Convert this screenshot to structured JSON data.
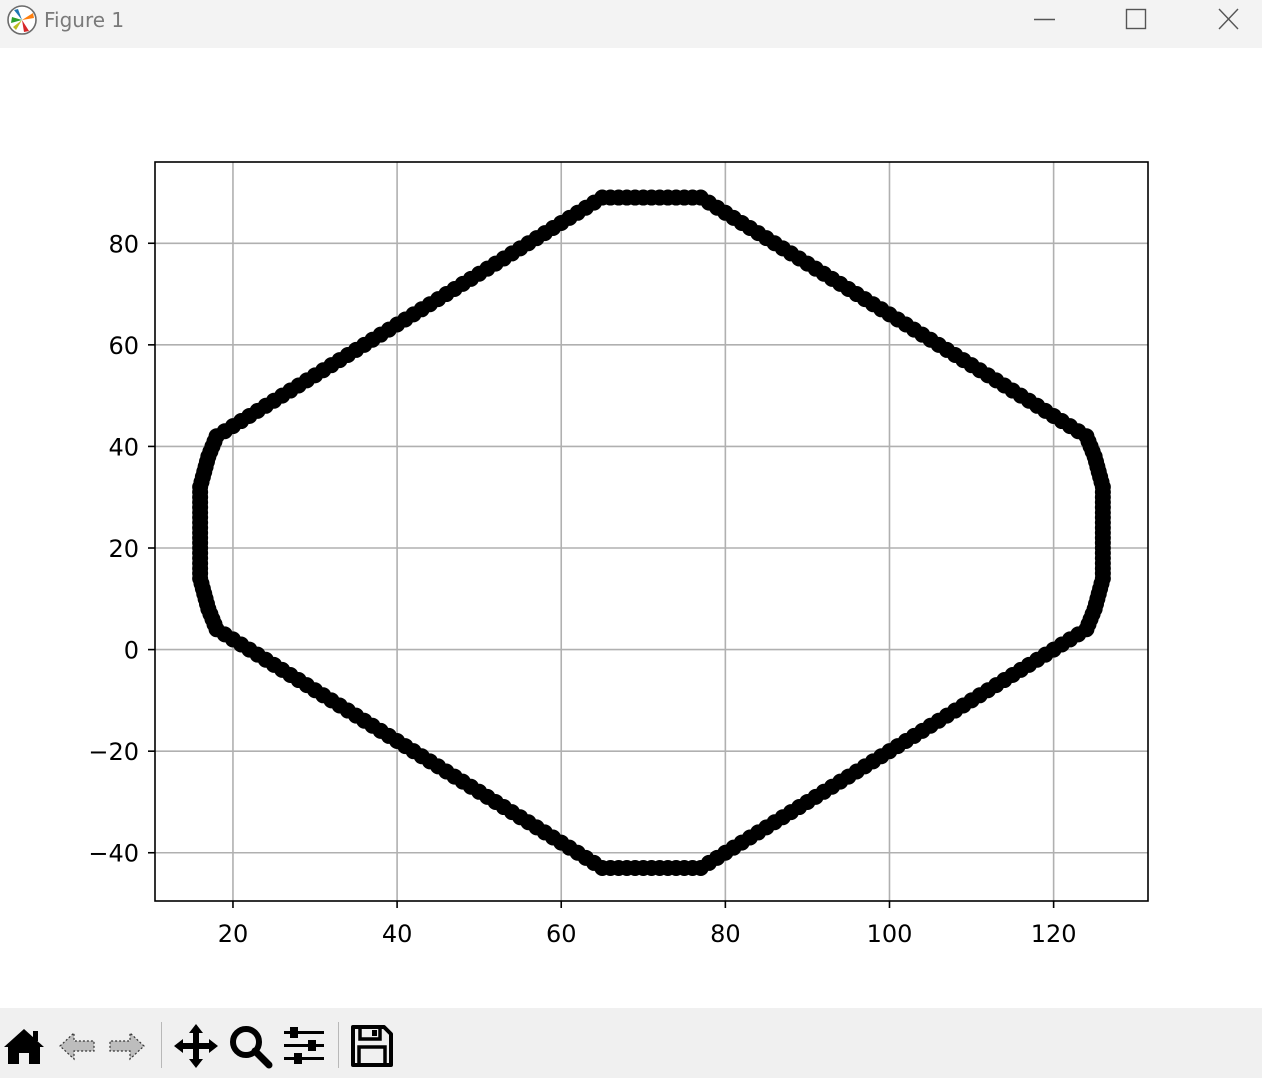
{
  "window": {
    "title": "Figure 1",
    "icon": "matplotlib-logo-icon",
    "controls": [
      "minimize-icon",
      "maximize-icon",
      "close-icon"
    ]
  },
  "toolbar": {
    "tools": [
      "home-icon",
      "back-arrow-icon",
      "forward-arrow-icon",
      "pan-move-icon",
      "zoom-magnifier-icon",
      "configure-subplots-icon",
      "save-floppy-icon"
    ]
  },
  "chart_data": {
    "type": "scatter",
    "title": "",
    "xlabel": "",
    "ylabel": "",
    "xlim": [
      10.5,
      131.5
    ],
    "ylim": [
      -49.5,
      96
    ],
    "grid": true,
    "marker_color": "#000000",
    "xticks": [
      20,
      40,
      60,
      80,
      100,
      120
    ],
    "yticks": [
      -40,
      -20,
      0,
      20,
      40,
      60,
      80
    ],
    "xtick_labels": [
      "20",
      "40",
      "60",
      "80",
      "100",
      "120"
    ],
    "ytick_labels": [
      "−40",
      "−20",
      "0",
      "20",
      "40",
      "60",
      "80"
    ],
    "series": [
      {
        "vertices": [
          [
            65,
            89
          ],
          [
            77,
            89
          ],
          [
            124,
            42
          ],
          [
            125,
            38
          ],
          [
            126,
            32
          ],
          [
            126,
            14
          ],
          [
            125,
            8
          ],
          [
            124,
            4
          ],
          [
            77,
            -43
          ],
          [
            65,
            -43
          ],
          [
            18,
            4
          ],
          [
            17,
            8
          ],
          [
            16,
            14
          ],
          [
            16,
            32
          ],
          [
            17,
            38
          ],
          [
            18,
            42
          ]
        ]
      }
    ]
  }
}
